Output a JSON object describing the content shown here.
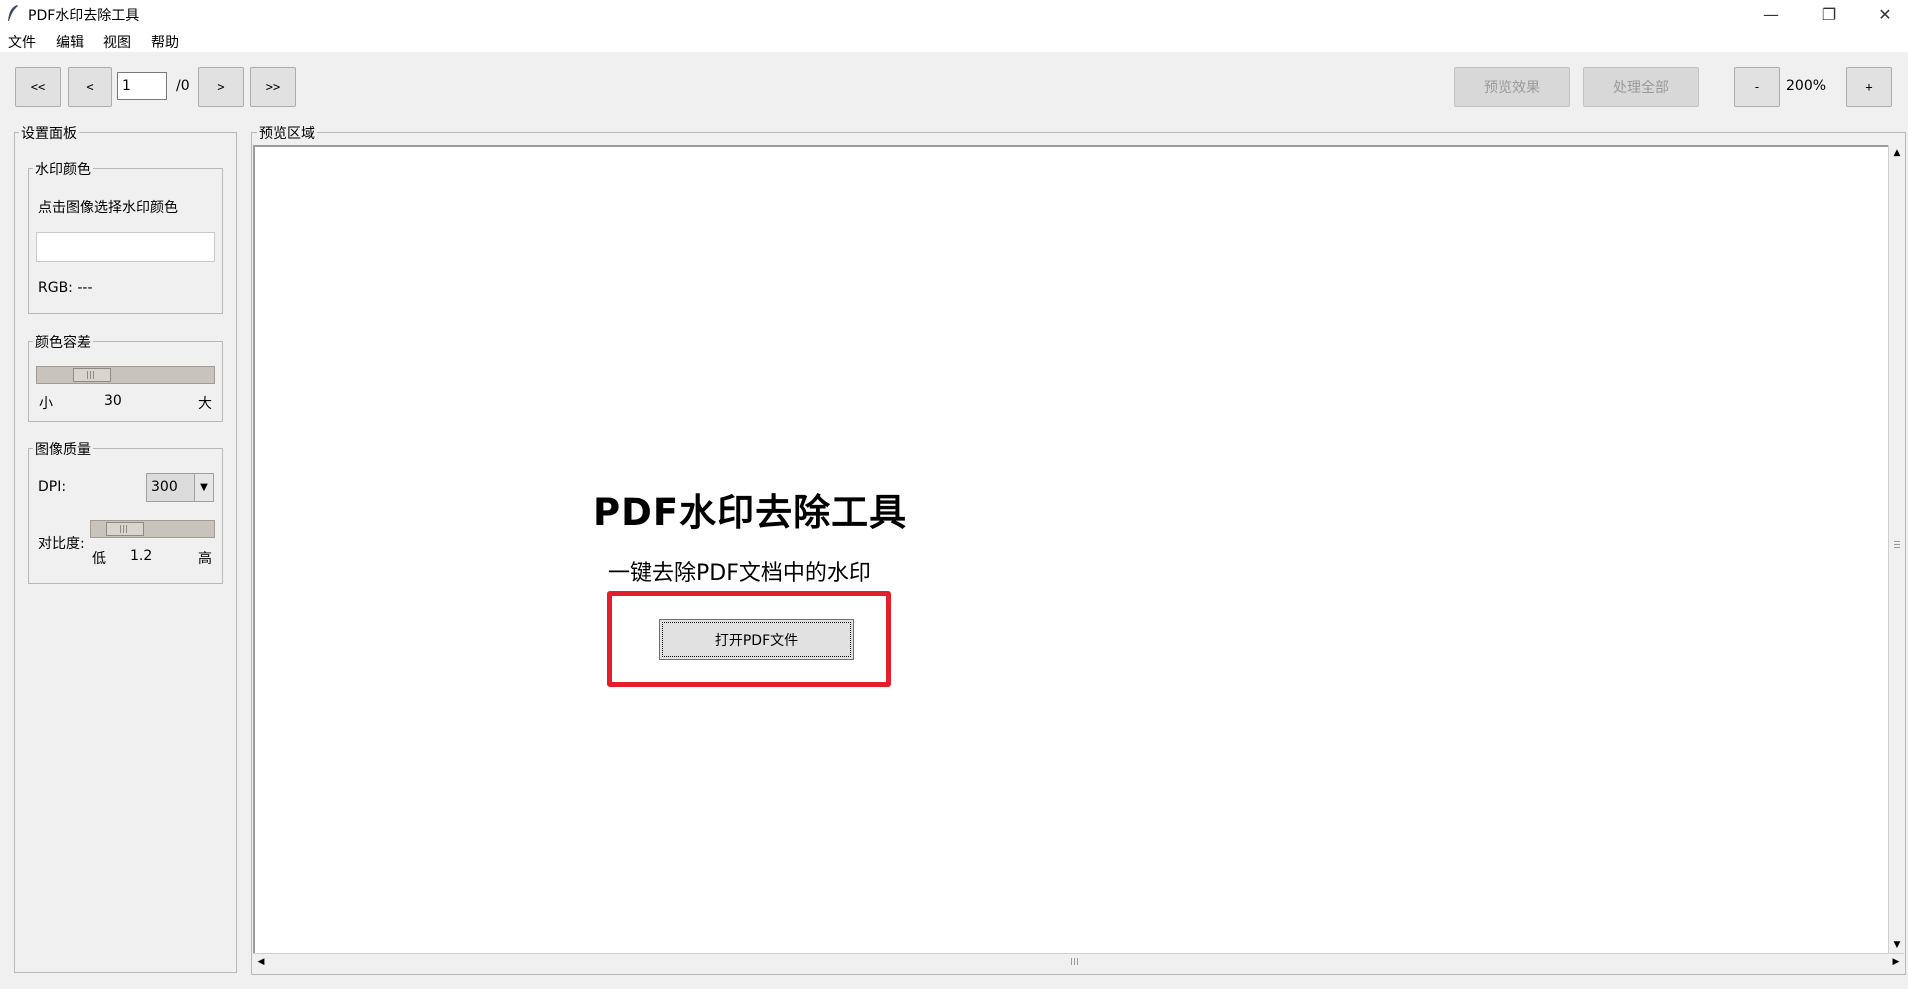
{
  "window": {
    "title": "PDF水印去除工具",
    "min_glyph": "—",
    "restore_glyph": "❐",
    "close_glyph": "✕"
  },
  "menu": [
    "文件",
    "编辑",
    "视图",
    "帮助"
  ],
  "toolbar": {
    "first_label": "<<",
    "prev_label": "<",
    "page_value": "1",
    "page_total": "/0",
    "next_label": ">",
    "last_label": ">>",
    "preview_label": "预览效果",
    "process_all_label": "处理全部",
    "zoom_out_label": "-",
    "zoom_level": "200%",
    "zoom_in_label": "+"
  },
  "settings": {
    "panel_title": "设置面板",
    "watermark_color": {
      "group_title": "水印颜色",
      "hint": "点击图像选择水印颜色",
      "rgb_text": "RGB: ---"
    },
    "tolerance": {
      "group_title": "颜色容差",
      "min_label": "小",
      "value": "30",
      "max_label": "大",
      "level": 0.3
    },
    "quality": {
      "group_title": "图像质量",
      "dpi_label": "DPI:",
      "dpi_value": "300",
      "contrast_label": "对比度:",
      "contrast_min": "低",
      "contrast_value": "1.2",
      "contrast_max": "高",
      "contrast_level": 0.25
    }
  },
  "preview": {
    "area_title": "预览区域",
    "heading": "PDF水印去除工具",
    "subtitle": "一键去除PDF文档中的水印",
    "open_button": "打开PDF文件"
  },
  "colors": {
    "highlight": "#e41e2b"
  }
}
